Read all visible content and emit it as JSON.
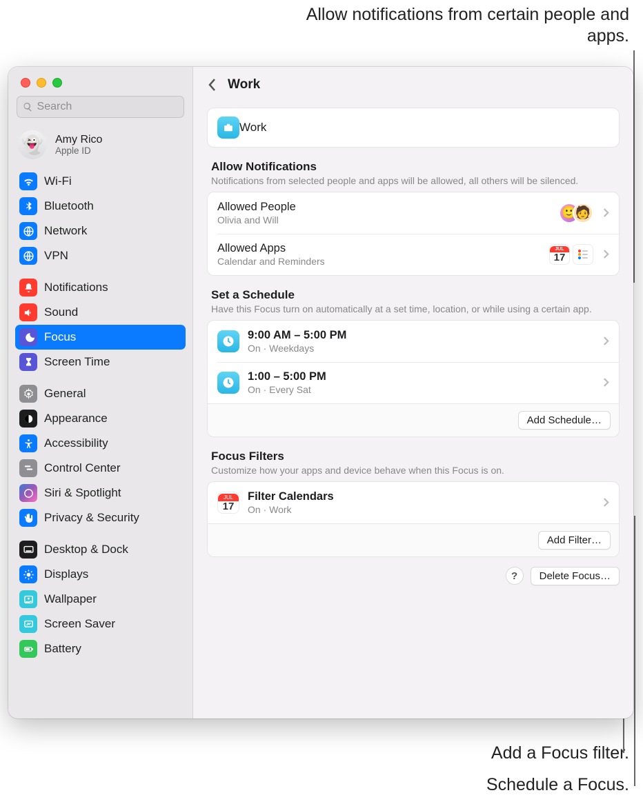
{
  "callouts": {
    "top": "Allow notifications from certain people and apps.",
    "filter": "Add a Focus filter.",
    "schedule": "Schedule a Focus."
  },
  "search": {
    "placeholder": "Search"
  },
  "account": {
    "name": "Amy Rico",
    "sub": "Apple ID"
  },
  "sidebar": {
    "groups": [
      {
        "items": [
          {
            "label": "Wi-Fi",
            "color": "#0a7aff",
            "icon": "wifi"
          },
          {
            "label": "Bluetooth",
            "color": "#0a7aff",
            "icon": "bluetooth"
          },
          {
            "label": "Network",
            "color": "#0a7aff",
            "icon": "globe"
          },
          {
            "label": "VPN",
            "color": "#0a7aff",
            "icon": "globe"
          }
        ]
      },
      {
        "items": [
          {
            "label": "Notifications",
            "color": "#ff3b30",
            "icon": "bell"
          },
          {
            "label": "Sound",
            "color": "#ff3b30",
            "icon": "sound"
          },
          {
            "label": "Focus",
            "color": "#5856d6",
            "icon": "moon",
            "selected": true
          },
          {
            "label": "Screen Time",
            "color": "#5856d6",
            "icon": "hourglass"
          }
        ]
      },
      {
        "items": [
          {
            "label": "General",
            "color": "#8e8e93",
            "icon": "gear"
          },
          {
            "label": "Appearance",
            "color": "#1d1d1f",
            "icon": "appearance"
          },
          {
            "label": "Accessibility",
            "color": "#0a7aff",
            "icon": "accessibility"
          },
          {
            "label": "Control Center",
            "color": "#8e8e93",
            "icon": "switches"
          },
          {
            "label": "Siri & Spotlight",
            "color": "linear-gradient(135deg,#3a7bd5,#9b59b6,#ff6ec4)",
            "icon": "siri"
          },
          {
            "label": "Privacy & Security",
            "color": "#0a7aff",
            "icon": "hand"
          }
        ]
      },
      {
        "items": [
          {
            "label": "Desktop & Dock",
            "color": "#1d1d1f",
            "icon": "dock"
          },
          {
            "label": "Displays",
            "color": "#0a7aff",
            "icon": "displays"
          },
          {
            "label": "Wallpaper",
            "color": "#34c9dd",
            "icon": "wallpaper"
          },
          {
            "label": "Screen Saver",
            "color": "#34c9dd",
            "icon": "screensaver"
          },
          {
            "label": "Battery",
            "color": "#34c759",
            "icon": "battery"
          }
        ]
      }
    ]
  },
  "main": {
    "title": "Work",
    "focus_name": "Work",
    "allow": {
      "heading": "Allow Notifications",
      "desc": "Notifications from selected people and apps will be allowed, all others will be silenced.",
      "people": {
        "title": "Allowed People",
        "sub": "Olivia and Will"
      },
      "apps": {
        "title": "Allowed Apps",
        "sub": "Calendar and Reminders"
      }
    },
    "schedule": {
      "heading": "Set a Schedule",
      "desc": "Have this Focus turn on automatically at a set time, location, or while using a certain app.",
      "items": [
        {
          "title": "9:00 AM – 5:00 PM",
          "sub": "On · Weekdays"
        },
        {
          "title": "1:00 – 5:00 PM",
          "sub": "On · Every Sat"
        }
      ],
      "add_label": "Add Schedule…"
    },
    "filters": {
      "heading": "Focus Filters",
      "desc": "Customize how your apps and device behave when this Focus is on.",
      "items": [
        {
          "title": "Filter Calendars",
          "sub": "On · Work"
        }
      ],
      "add_label": "Add Filter…"
    },
    "help": "?",
    "delete_label": "Delete Focus…"
  }
}
